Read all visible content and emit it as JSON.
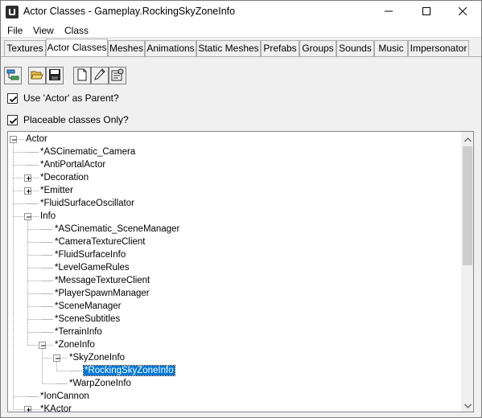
{
  "window": {
    "title": "Actor Classes - Gameplay.RockingSkyZoneInfo"
  },
  "menu": [
    "File",
    "View",
    "Class"
  ],
  "tabs": [
    {
      "label": "Textures"
    },
    {
      "label": "Actor Classes",
      "active": true
    },
    {
      "label": "Meshes"
    },
    {
      "label": "Animations"
    },
    {
      "label": "Static Meshes"
    },
    {
      "label": "Prefabs"
    },
    {
      "label": "Groups"
    },
    {
      "label": "Sounds"
    },
    {
      "label": "Music"
    },
    {
      "label": "Impersonator"
    }
  ],
  "toolbar": {
    "buttons": [
      "class-tree-icon",
      "open-folder-icon",
      "save-icon",
      "new-document-icon",
      "edit-pencil-icon",
      "properties-icon"
    ]
  },
  "options": {
    "use_actor_parent": {
      "label": "Use 'Actor' as Parent?",
      "checked": true
    },
    "placeable_only": {
      "label": "Placeable classes Only?",
      "checked": true
    }
  },
  "tree": {
    "nodes": [
      {
        "label": "Actor",
        "depth": 0,
        "expander": "minus"
      },
      {
        "label": "*ASCinematic_Camera",
        "depth": 1
      },
      {
        "label": "*AntiPortalActor",
        "depth": 1
      },
      {
        "label": "*Decoration",
        "depth": 1,
        "expander": "plus"
      },
      {
        "label": "*Emitter",
        "depth": 1,
        "expander": "plus"
      },
      {
        "label": "*FluidSurfaceOscillator",
        "depth": 1
      },
      {
        "label": "Info",
        "depth": 1,
        "expander": "minus"
      },
      {
        "label": "*ASCinematic_SceneManager",
        "depth": 2
      },
      {
        "label": "*CameraTextureClient",
        "depth": 2
      },
      {
        "label": "*FluidSurfaceInfo",
        "depth": 2
      },
      {
        "label": "*LevelGameRules",
        "depth": 2
      },
      {
        "label": "*MessageTextureClient",
        "depth": 2
      },
      {
        "label": "*PlayerSpawnManager",
        "depth": 2
      },
      {
        "label": "*SceneManager",
        "depth": 2
      },
      {
        "label": "*SceneSubtitles",
        "depth": 2
      },
      {
        "label": "*TerrainInfo",
        "depth": 2
      },
      {
        "label": "*ZoneInfo",
        "depth": 2,
        "expander": "minus"
      },
      {
        "label": "*SkyZoneInfo",
        "depth": 3,
        "expander": "minus"
      },
      {
        "label": "*RockingSkyZoneInfo",
        "depth": 4,
        "selected": true
      },
      {
        "label": "*WarpZoneInfo",
        "depth": 3
      },
      {
        "label": "*IonCannon",
        "depth": 1
      },
      {
        "label": "*KActor",
        "depth": 1,
        "expander": "plus"
      }
    ]
  },
  "colors": {
    "selection": "#0078d7",
    "tree_lines": "#a0a0a0"
  }
}
